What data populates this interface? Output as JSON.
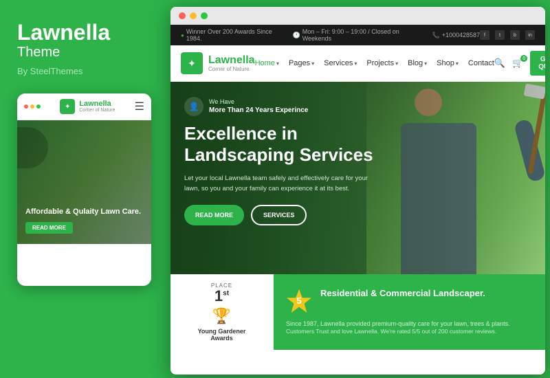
{
  "left": {
    "brand": "Lawnella",
    "theme_label": "Theme",
    "author": "By SteelThemes",
    "mobile": {
      "logo_text": "Lawnella",
      "logo_sub": "Corner of Nature",
      "hero_title": "Affordable & Qulaity Lawn Care.",
      "read_more": "READ MORE"
    }
  },
  "browser": {
    "topbar": {
      "award_text": "Winner Over 200 Awards Since 1984.",
      "hours_text": "Mon – Fri: 9:00 – 19:00 / Closed on Weekends",
      "phone": "+1000428587",
      "socials": [
        "f",
        "t",
        "b",
        "in"
      ]
    },
    "nav": {
      "logo_text": "Lawnella",
      "logo_sub": "Corner of Nature",
      "links": [
        {
          "label": "Home",
          "has_arrow": true
        },
        {
          "label": "Pages",
          "has_arrow": true
        },
        {
          "label": "Services",
          "has_arrow": true
        },
        {
          "label": "Projects",
          "has_arrow": true
        },
        {
          "label": "Blog",
          "has_arrow": true
        },
        {
          "label": "Shop",
          "has_arrow": true
        },
        {
          "label": "Contact",
          "has_arrow": false
        }
      ],
      "quote_btn": "GET A QUOTE"
    },
    "hero": {
      "badge_line1": "We Have",
      "badge_line2": "More Than 24 Years Experince",
      "title_line1": "Excellence in",
      "title_line2": "Landscaping Services",
      "description": "Let your local Lawnella team safely and effectively care for your lawn, so you and your family can experience it at its best.",
      "btn_read_more": "READ MORE",
      "btn_services": "SERVICES"
    },
    "award_card": {
      "place_label": "PLACE",
      "number": "1",
      "suffix": "st",
      "title_line1": "Young Gardener",
      "title_line2": "Awards"
    },
    "promo_card": {
      "star_number": "5",
      "title": "Residential & Commercial Landscaper.",
      "desc": "Since 1987, Lawnella provided premium-quality care for your lawn, trees & plants.",
      "sub_desc": "Customers Trust and love Lawnella. We're rated 5/5 out of 200 customer reviews."
    }
  }
}
